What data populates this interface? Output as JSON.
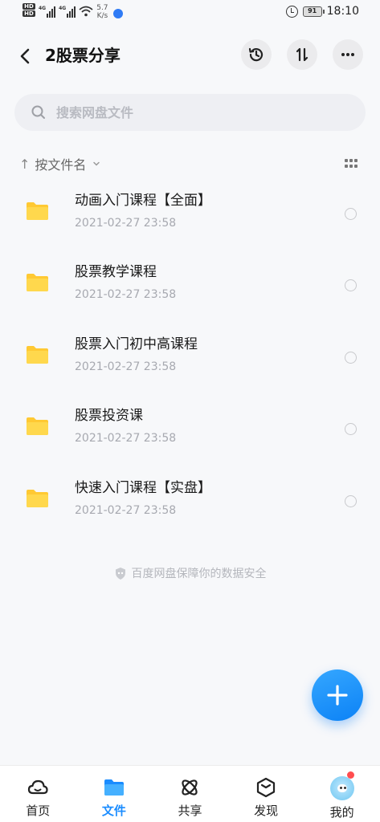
{
  "status_bar": {
    "hd_label": "HD",
    "network_label": "4G",
    "speed_value": "5.7",
    "speed_unit": "K/s",
    "battery": "91",
    "time": "18:10"
  },
  "header": {
    "title": "2股票分享"
  },
  "search": {
    "placeholder": "搜索网盘文件"
  },
  "sort": {
    "label": "按文件名"
  },
  "files": [
    {
      "name": "动画入门课程【全面】",
      "date": "2021-02-27  23:58"
    },
    {
      "name": "股票教学课程",
      "date": "2021-02-27  23:58"
    },
    {
      "name": "股票入门初中高课程",
      "date": "2021-02-27  23:58"
    },
    {
      "name": "股票投资课",
      "date": "2021-02-27  23:58"
    },
    {
      "name": "快速入门课程【实盘】",
      "date": "2021-02-27  23:58"
    }
  ],
  "footer_note": "百度网盘保障你的数据安全",
  "tabs": [
    {
      "label": "首页",
      "icon": "cloud-icon"
    },
    {
      "label": "文件",
      "icon": "folder-icon"
    },
    {
      "label": "共享",
      "icon": "share-icon"
    },
    {
      "label": "发现",
      "icon": "discover-icon"
    },
    {
      "label": "我的",
      "icon": "avatar"
    }
  ],
  "colors": {
    "accent": "#1a8cff",
    "folder": "#ffc933",
    "background": "#f7f8fa"
  }
}
